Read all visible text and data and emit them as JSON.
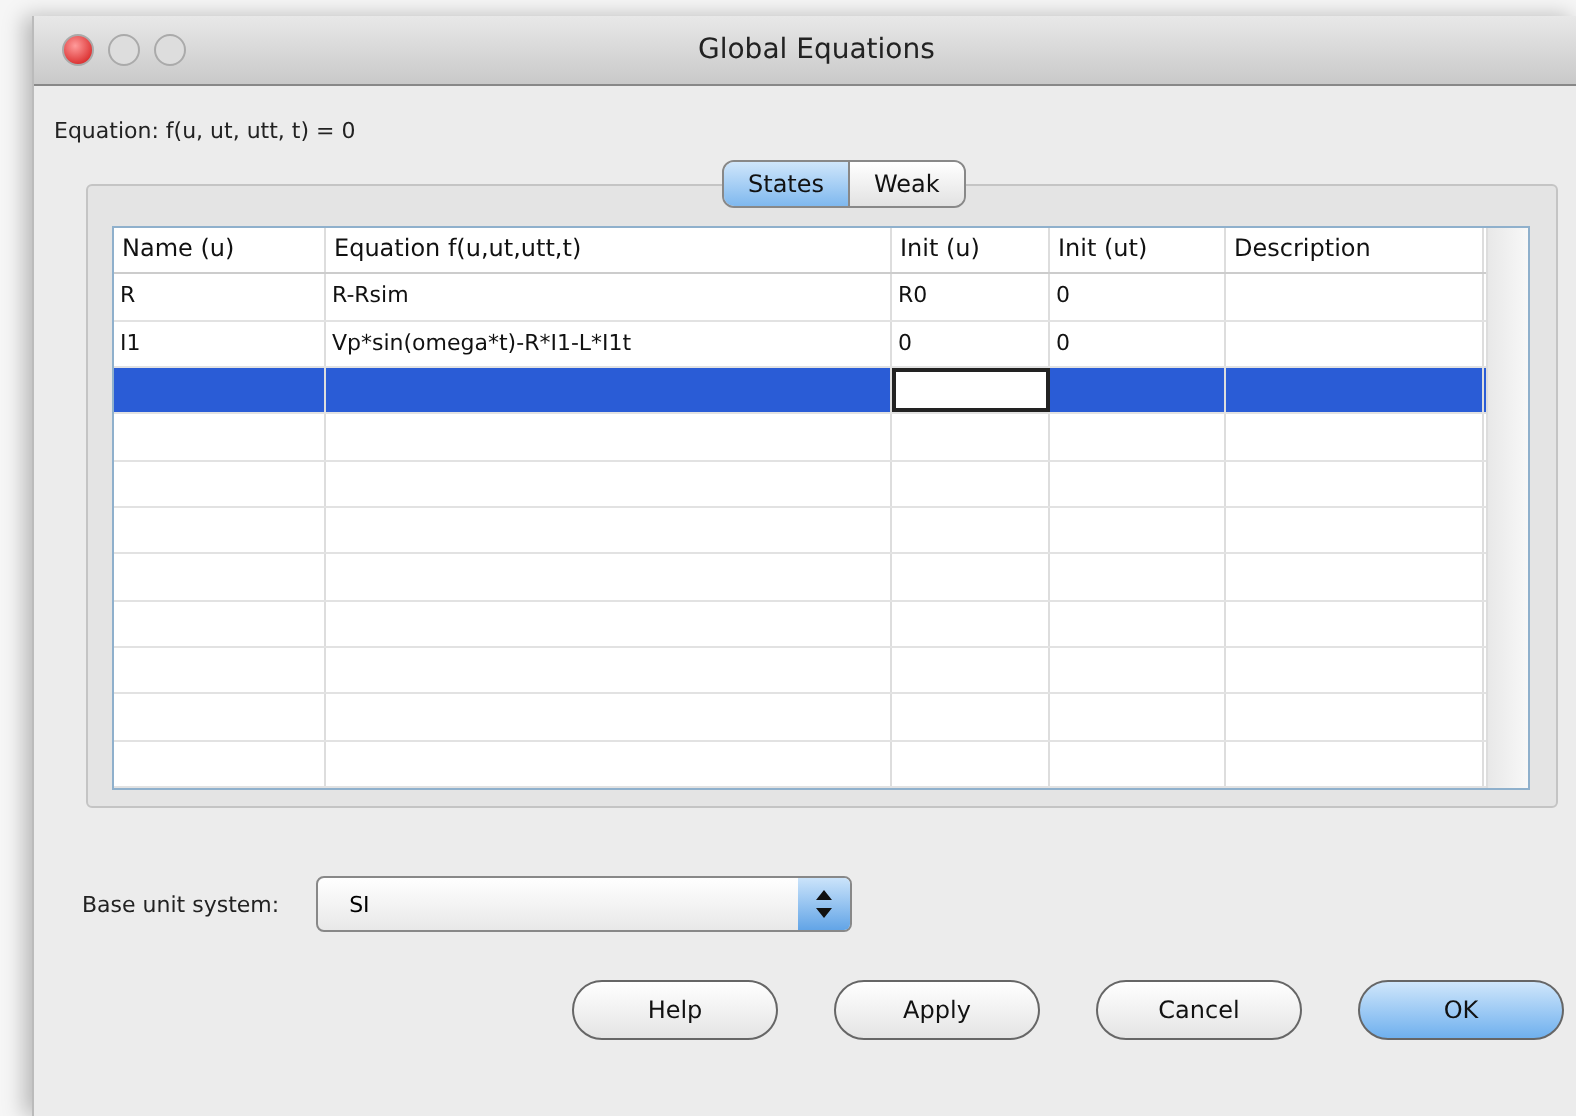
{
  "window": {
    "title": "Global Equations"
  },
  "equation_label": "Equation: f(u, ut, utt, t) = 0",
  "tabs": [
    {
      "label": "States",
      "selected": true
    },
    {
      "label": "Weak",
      "selected": false
    }
  ],
  "table": {
    "columns": [
      "Name (u)",
      "Equation f(u,ut,utt,t)",
      "Init (u)",
      "Init (ut)",
      "Description"
    ],
    "rows": [
      {
        "cells": [
          "R",
          "R-Rsim",
          "R0",
          "0"
        ],
        "selected": false
      },
      {
        "cells": [
          "I1",
          "Vp*sin(omega*t)-R*I1-L*I1t",
          "0",
          "0"
        ],
        "selected": false
      },
      {
        "selected": true,
        "editing_cells": [
          false,
          false,
          true,
          false,
          false
        ]
      }
    ]
  },
  "unit_system": {
    "label": "Base unit system:",
    "value": "SI"
  },
  "buttons": [
    {
      "label": "Help",
      "default": false
    },
    {
      "label": "Apply",
      "default": false
    },
    {
      "label": "Cancel",
      "default": false
    },
    {
      "label": "OK",
      "default": true
    }
  ]
}
